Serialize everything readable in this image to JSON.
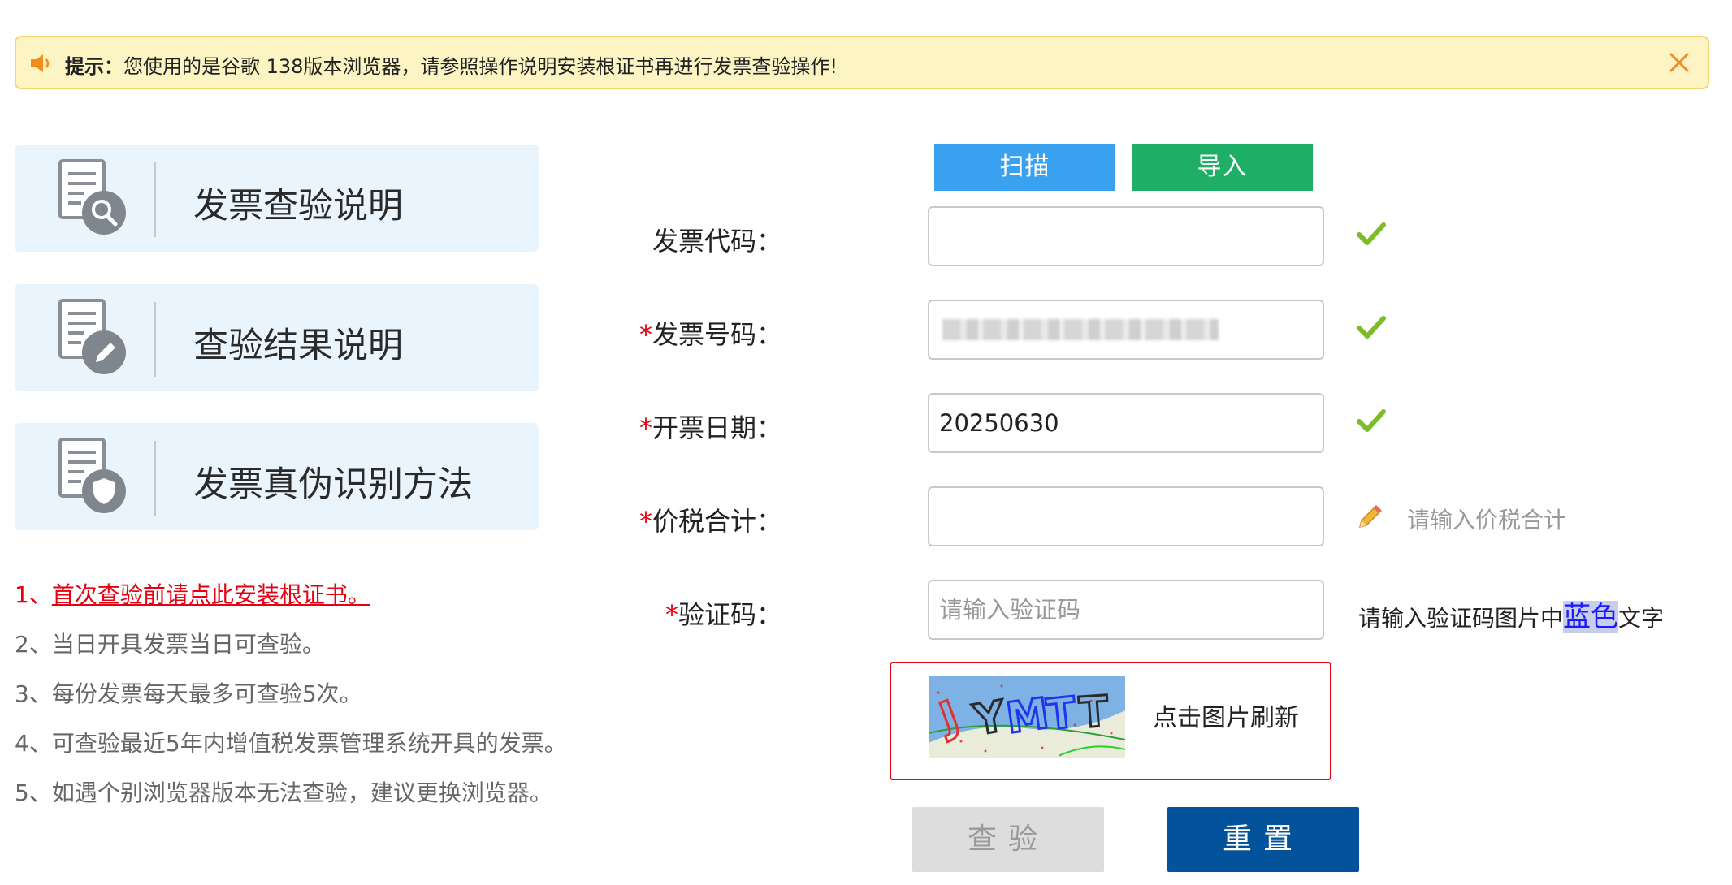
{
  "notice": {
    "prefix": "提示：",
    "message": "您使用的是谷歌 138版本浏览器，请参照操作说明安装根证书再进行发票查验操作!"
  },
  "nav_cards": [
    {
      "label": "发票查验说明",
      "icon": "document-search-icon"
    },
    {
      "label": "查验结果说明",
      "icon": "document-edit-icon"
    },
    {
      "label": "发票真伪识别方法",
      "icon": "document-shield-icon"
    }
  ],
  "notes": {
    "n1_prefix": "1、",
    "n1_link": "首次查验前请点此安装根证书。",
    "n2": "2、当日开具发票当日可查验。",
    "n3": "3、每份发票每天最多可查验5次。",
    "n4": "4、可查验最近5年内增值税发票管理系统开具的发票。",
    "n5": "5、如遇个别浏览器版本无法查验，建议更换浏览器。"
  },
  "buttons": {
    "scan": "扫描",
    "import": "导入",
    "query": "查验",
    "reset": "重置"
  },
  "form": {
    "invoice_code": {
      "label": "发票代码：",
      "value": ""
    },
    "invoice_number": {
      "star": "*",
      "label": "发票号码：",
      "value": ""
    },
    "invoice_date": {
      "star": "*",
      "label": "开票日期：",
      "value": "20250630"
    },
    "total_amount": {
      "star": "*",
      "label": "价税合计：",
      "value": "",
      "hint": "请输入价税合计"
    },
    "captcha": {
      "star": "*",
      "label": "验证码：",
      "placeholder": "请输入验证码",
      "hint_before": "请输入验证码图片中",
      "hint_color_word": "蓝色",
      "hint_after": "文字",
      "refresh_text": "点击图片刷新"
    }
  },
  "colors": {
    "notice_bg": "#fcf5c3",
    "card_bg": "#eaf4fd",
    "scan_btn": "#3aa1f0",
    "import_btn": "#1fae66",
    "reset_btn": "#02539b",
    "required_star": "#e60012"
  }
}
